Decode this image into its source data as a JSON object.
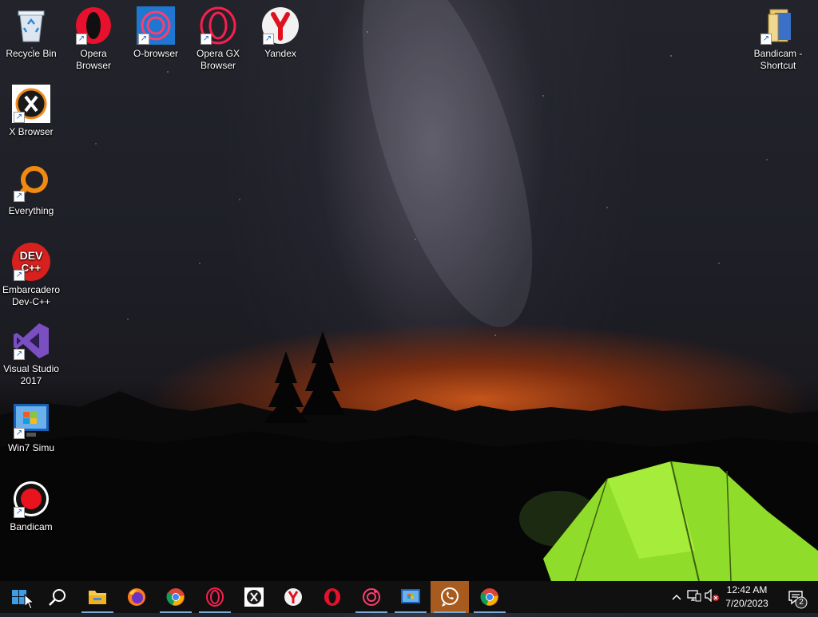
{
  "desktop": {
    "icons": [
      {
        "label": "Recycle Bin"
      },
      {
        "label": "Opera Browser"
      },
      {
        "label": "O-browser"
      },
      {
        "label": "Opera GX Browser"
      },
      {
        "label": "Yandex"
      },
      {
        "label": "Bandicam - Shortcut"
      },
      {
        "label": "X Browser"
      },
      {
        "label": "Everything"
      },
      {
        "label": "Embarcadero Dev-C++"
      },
      {
        "label": "Visual Studio 2017"
      },
      {
        "label": "Win7 Simu"
      },
      {
        "label": "Bandicam"
      }
    ],
    "devcpp_badge": "DEV C++"
  },
  "taskbar": {
    "pinned": [
      "start",
      "search",
      "file-explorer",
      "firefox",
      "chrome",
      "opera-gx",
      "x-browser",
      "yandex",
      "opera",
      "o-browser",
      "win7-simu",
      "whatsapp",
      "chrome"
    ],
    "clock": {
      "time": "12:42 AM",
      "date": "7/20/2023"
    },
    "notification_count": "2"
  },
  "colors": {
    "taskbar_bg": "#101010",
    "active_app": "#a85b1f",
    "tent": "#8fdc2a"
  }
}
